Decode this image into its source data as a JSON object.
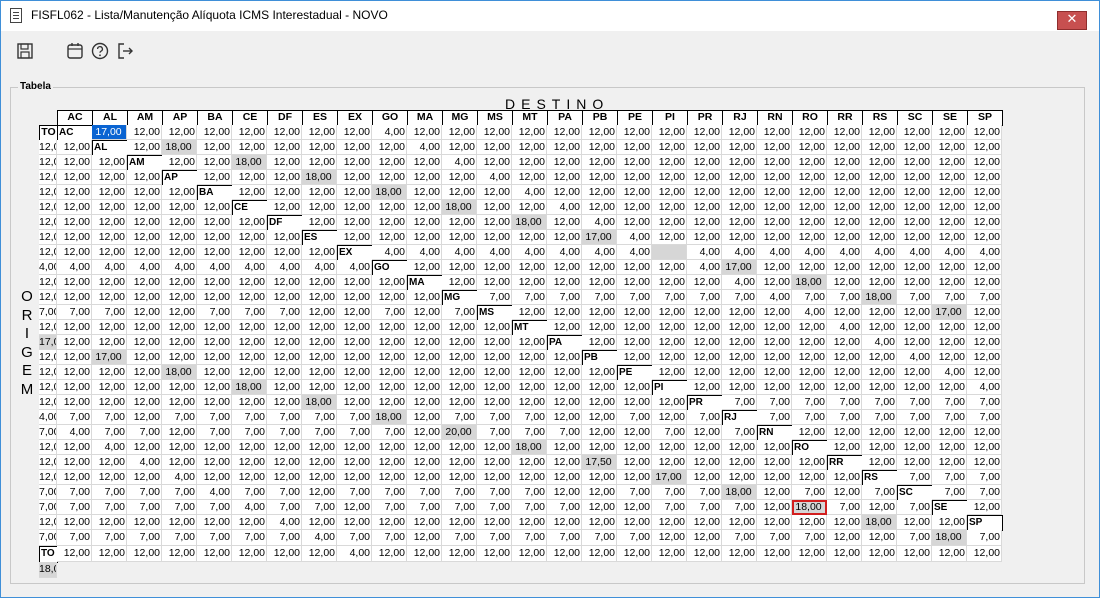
{
  "window": {
    "title": "FISFL062 - Lista/Manutenção Alíquota ICMS Interestadual - NOVO",
    "close_glyph": "✕"
  },
  "toolbar": {
    "buttons": [
      {
        "name": "save-icon"
      },
      {
        "name": "calendar-icon"
      },
      {
        "name": "help-icon"
      },
      {
        "name": "exit-icon"
      }
    ]
  },
  "table": {
    "group_label": "Tabela",
    "destino_label": "DESTINO",
    "origem_label": "ORIGEM",
    "states": [
      "AC",
      "AL",
      "AM",
      "AP",
      "BA",
      "CE",
      "DF",
      "ES",
      "EX",
      "GO",
      "MA",
      "MG",
      "MS",
      "MT",
      "PA",
      "PB",
      "PE",
      "PI",
      "PR",
      "RJ",
      "RN",
      "RO",
      "RR",
      "RS",
      "SC",
      "SE",
      "SP",
      "TO"
    ],
    "diagonal": {
      "AC": "17,00",
      "AL": "18,00",
      "AM": "18,00",
      "AP": "18,00",
      "BA": "18,00",
      "CE": "18,00",
      "DF": "18,00",
      "ES": "17,00",
      "EX": "",
      "GO": "17,00",
      "MA": "18,00",
      "MG": "18,00",
      "MS": "17,00",
      "MT": "17,00",
      "PA": "17,00",
      "PB": "18,00",
      "PE": "18,00",
      "PI": "18,00",
      "PR": "18,00",
      "RJ": "20,00",
      "RN": "18,00",
      "RO": "17,50",
      "RR": "17,00",
      "RS": "18,00",
      "SC": "18,00",
      "SE": "18,00",
      "SP": "18,00",
      "TO": "18,00"
    },
    "rate_high": "12,00",
    "rate_low": "7,00",
    "rate_ex": "4,00",
    "low_origins": [
      "MG",
      "PR",
      "RJ",
      "RS",
      "SC",
      "SP"
    ],
    "low_destinations_prefix": [
      "AC",
      "AL",
      "AM",
      "AP",
      "BA",
      "CE",
      "DF",
      "ES",
      "GO",
      "MA",
      "MS",
      "MT",
      "PA",
      "PB",
      "PE",
      "PI",
      "RN",
      "RO",
      "RR",
      "SE",
      "TO"
    ],
    "selected_cell": {
      "row": "AC",
      "col": "AC"
    },
    "focused_cell": {
      "row": "SC",
      "col": "SC"
    }
  }
}
